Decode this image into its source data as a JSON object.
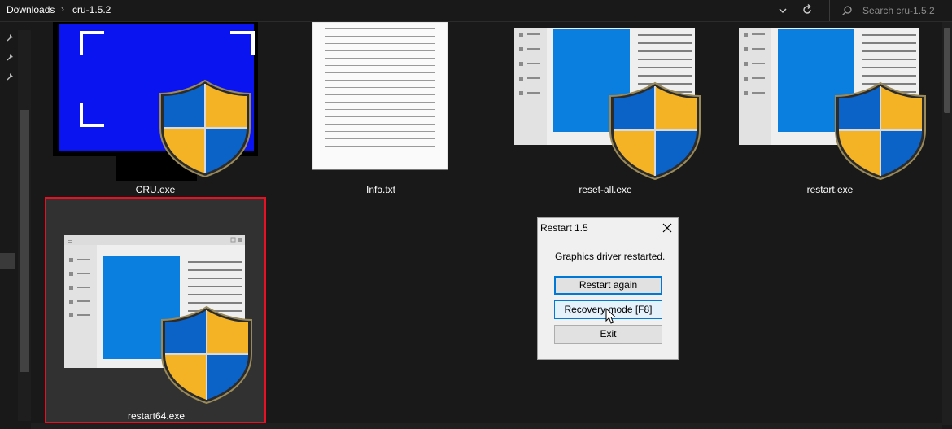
{
  "breadcrumb": {
    "items": [
      "Downloads",
      "cru-1.5.2"
    ],
    "separator": "›"
  },
  "search": {
    "placeholder": "Search cru-1.5.2"
  },
  "files": [
    {
      "name": "CRU.exe"
    },
    {
      "name": "Info.txt"
    },
    {
      "name": "reset-all.exe"
    },
    {
      "name": "restart.exe"
    },
    {
      "name": "restart64.exe",
      "selected": true
    }
  ],
  "dialog": {
    "title": "Restart 1.5",
    "message": "Graphics driver restarted.",
    "buttons": {
      "restart_again": "Restart again",
      "recovery_mode": "Recovery mode [F8]",
      "exit": "Exit"
    }
  },
  "colors": {
    "selection_border": "#e81123",
    "shield_blue": "#0a63c9",
    "shield_yellow": "#f2b619",
    "app_blue": "#0b7fe0"
  }
}
